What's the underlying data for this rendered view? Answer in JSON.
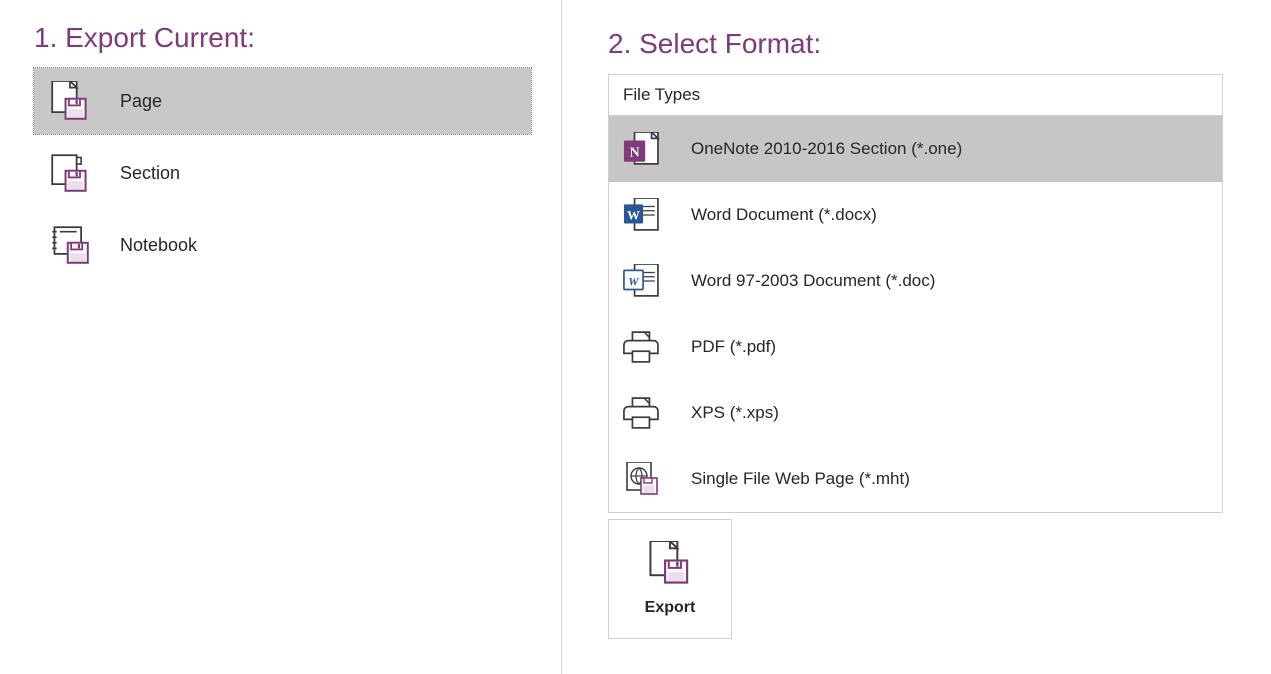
{
  "colors": {
    "accent": "#80397B",
    "wordBlue": "#2B579A"
  },
  "left": {
    "heading": "1. Export Current:",
    "items": [
      {
        "label": "Page",
        "selected": true
      },
      {
        "label": "Section",
        "selected": false
      },
      {
        "label": "Notebook",
        "selected": false
      }
    ]
  },
  "right": {
    "heading": "2. Select Format:",
    "groupHeader": "File Types",
    "items": [
      {
        "label": "OneNote 2010-2016 Section (*.one)",
        "selected": true
      },
      {
        "label": "Word Document (*.docx)",
        "selected": false
      },
      {
        "label": "Word 97-2003 Document (*.doc)",
        "selected": false
      },
      {
        "label": "PDF (*.pdf)",
        "selected": false
      },
      {
        "label": "XPS (*.xps)",
        "selected": false
      },
      {
        "label": "Single File Web Page (*.mht)",
        "selected": false
      }
    ],
    "exportButton": "Export"
  }
}
